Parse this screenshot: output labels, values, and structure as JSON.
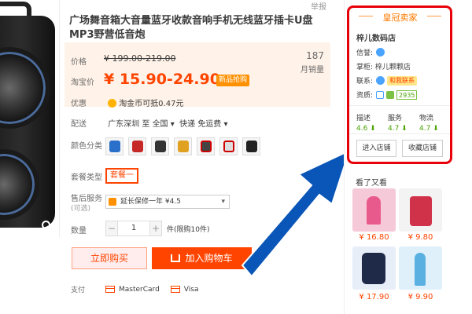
{
  "report": "举报",
  "title": "广场舞音箱大音量蓝牙收款音响手机无线蓝牙插卡U盘MP3野营低音炮",
  "price": {
    "label": "价格",
    "original": "¥ 199.00-219.00",
    "taobao_label": "淘宝价",
    "current": "¥ 15.90-24.90",
    "promo_tag": "新品抢购",
    "sales_count": "187",
    "sales_label": "月销量"
  },
  "discount": {
    "label": "优惠",
    "value": "淘金币可抵0.47元"
  },
  "shipping": {
    "label": "配送",
    "from": "广东深圳 至",
    "to": "全国",
    "service": "快递 免运费"
  },
  "color": {
    "label": "颜色分类",
    "thumb_count": 7
  },
  "package": {
    "label": "套餐类型",
    "option": "套餐一"
  },
  "after_sales": {
    "label": "售后服务",
    "sub_label": "(可选)",
    "option": "延长保修一年 ¥4.5"
  },
  "quantity": {
    "label": "数量",
    "minus": "−",
    "value": "1",
    "plus": "+",
    "tip": "件(限购10件)"
  },
  "buttons": {
    "buy_now": "立即购买",
    "add_cart": "加入购物车"
  },
  "payment": {
    "label": "支付",
    "methods": [
      "MasterCard",
      "Visa"
    ]
  },
  "shop": {
    "badge": "皇冠卖家",
    "name": "梓儿数码店",
    "credit_label": "信誉:",
    "keeper_label": "掌柜:",
    "keeper": "梓儿颗颗店",
    "contact_label": "联系:",
    "contact_tag": "和我联系",
    "qual_label": "资质:",
    "qual_value": "2935",
    "scores": [
      {
        "label": "描述",
        "value": "4.6 ⬇"
      },
      {
        "label": "服务",
        "value": "4.7 ⬇"
      },
      {
        "label": "物流",
        "value": "4.7 ⬇"
      }
    ],
    "enter_shop": "进入店铺",
    "favorite_shop": "收藏店铺"
  },
  "also_viewed": {
    "title": "看了又看",
    "items": [
      {
        "price": "¥ 16.80",
        "color": "#e85a8c"
      },
      {
        "price": "¥ 9.80",
        "color": "#d0324a"
      },
      {
        "price": "¥ 17.90",
        "color": "#1e2a48"
      },
      {
        "price": "¥ 9.90",
        "color": "#5ab0e0"
      }
    ]
  },
  "colors": {
    "accent": "#ff4400",
    "shop_border": "#e8000b",
    "arrow": "#0a56b8"
  }
}
